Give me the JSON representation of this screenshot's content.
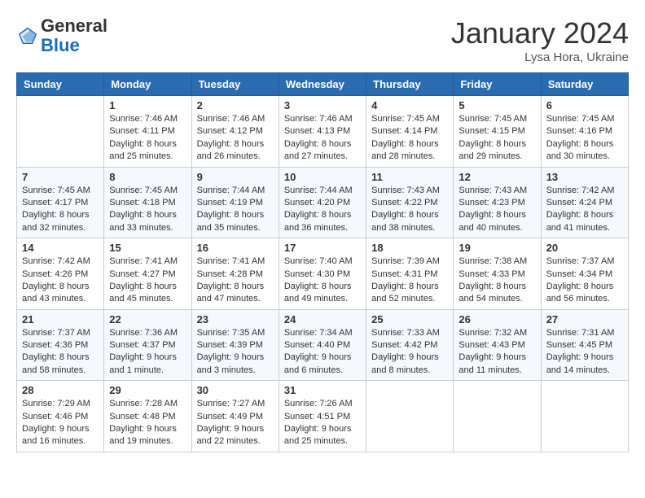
{
  "header": {
    "logo_general": "General",
    "logo_blue": "Blue",
    "month": "January 2024",
    "location": "Lysa Hora, Ukraine"
  },
  "columns": [
    "Sunday",
    "Monday",
    "Tuesday",
    "Wednesday",
    "Thursday",
    "Friday",
    "Saturday"
  ],
  "weeks": [
    [
      {
        "day": "",
        "content": ""
      },
      {
        "day": "1",
        "content": "Sunrise: 7:46 AM\nSunset: 4:11 PM\nDaylight: 8 hours\nand 25 minutes."
      },
      {
        "day": "2",
        "content": "Sunrise: 7:46 AM\nSunset: 4:12 PM\nDaylight: 8 hours\nand 26 minutes."
      },
      {
        "day": "3",
        "content": "Sunrise: 7:46 AM\nSunset: 4:13 PM\nDaylight: 8 hours\nand 27 minutes."
      },
      {
        "day": "4",
        "content": "Sunrise: 7:45 AM\nSunset: 4:14 PM\nDaylight: 8 hours\nand 28 minutes."
      },
      {
        "day": "5",
        "content": "Sunrise: 7:45 AM\nSunset: 4:15 PM\nDaylight: 8 hours\nand 29 minutes."
      },
      {
        "day": "6",
        "content": "Sunrise: 7:45 AM\nSunset: 4:16 PM\nDaylight: 8 hours\nand 30 minutes."
      }
    ],
    [
      {
        "day": "7",
        "content": "Sunrise: 7:45 AM\nSunset: 4:17 PM\nDaylight: 8 hours\nand 32 minutes."
      },
      {
        "day": "8",
        "content": "Sunrise: 7:45 AM\nSunset: 4:18 PM\nDaylight: 8 hours\nand 33 minutes."
      },
      {
        "day": "9",
        "content": "Sunrise: 7:44 AM\nSunset: 4:19 PM\nDaylight: 8 hours\nand 35 minutes."
      },
      {
        "day": "10",
        "content": "Sunrise: 7:44 AM\nSunset: 4:20 PM\nDaylight: 8 hours\nand 36 minutes."
      },
      {
        "day": "11",
        "content": "Sunrise: 7:43 AM\nSunset: 4:22 PM\nDaylight: 8 hours\nand 38 minutes."
      },
      {
        "day": "12",
        "content": "Sunrise: 7:43 AM\nSunset: 4:23 PM\nDaylight: 8 hours\nand 40 minutes."
      },
      {
        "day": "13",
        "content": "Sunrise: 7:42 AM\nSunset: 4:24 PM\nDaylight: 8 hours\nand 41 minutes."
      }
    ],
    [
      {
        "day": "14",
        "content": "Sunrise: 7:42 AM\nSunset: 4:26 PM\nDaylight: 8 hours\nand 43 minutes."
      },
      {
        "day": "15",
        "content": "Sunrise: 7:41 AM\nSunset: 4:27 PM\nDaylight: 8 hours\nand 45 minutes."
      },
      {
        "day": "16",
        "content": "Sunrise: 7:41 AM\nSunset: 4:28 PM\nDaylight: 8 hours\nand 47 minutes."
      },
      {
        "day": "17",
        "content": "Sunrise: 7:40 AM\nSunset: 4:30 PM\nDaylight: 8 hours\nand 49 minutes."
      },
      {
        "day": "18",
        "content": "Sunrise: 7:39 AM\nSunset: 4:31 PM\nDaylight: 8 hours\nand 52 minutes."
      },
      {
        "day": "19",
        "content": "Sunrise: 7:38 AM\nSunset: 4:33 PM\nDaylight: 8 hours\nand 54 minutes."
      },
      {
        "day": "20",
        "content": "Sunrise: 7:37 AM\nSunset: 4:34 PM\nDaylight: 8 hours\nand 56 minutes."
      }
    ],
    [
      {
        "day": "21",
        "content": "Sunrise: 7:37 AM\nSunset: 4:36 PM\nDaylight: 8 hours\nand 58 minutes."
      },
      {
        "day": "22",
        "content": "Sunrise: 7:36 AM\nSunset: 4:37 PM\nDaylight: 9 hours\nand 1 minute."
      },
      {
        "day": "23",
        "content": "Sunrise: 7:35 AM\nSunset: 4:39 PM\nDaylight: 9 hours\nand 3 minutes."
      },
      {
        "day": "24",
        "content": "Sunrise: 7:34 AM\nSunset: 4:40 PM\nDaylight: 9 hours\nand 6 minutes."
      },
      {
        "day": "25",
        "content": "Sunrise: 7:33 AM\nSunset: 4:42 PM\nDaylight: 9 hours\nand 8 minutes."
      },
      {
        "day": "26",
        "content": "Sunrise: 7:32 AM\nSunset: 4:43 PM\nDaylight: 9 hours\nand 11 minutes."
      },
      {
        "day": "27",
        "content": "Sunrise: 7:31 AM\nSunset: 4:45 PM\nDaylight: 9 hours\nand 14 minutes."
      }
    ],
    [
      {
        "day": "28",
        "content": "Sunrise: 7:29 AM\nSunset: 4:46 PM\nDaylight: 9 hours\nand 16 minutes."
      },
      {
        "day": "29",
        "content": "Sunrise: 7:28 AM\nSunset: 4:48 PM\nDaylight: 9 hours\nand 19 minutes."
      },
      {
        "day": "30",
        "content": "Sunrise: 7:27 AM\nSunset: 4:49 PM\nDaylight: 9 hours\nand 22 minutes."
      },
      {
        "day": "31",
        "content": "Sunrise: 7:26 AM\nSunset: 4:51 PM\nDaylight: 9 hours\nand 25 minutes."
      },
      {
        "day": "",
        "content": ""
      },
      {
        "day": "",
        "content": ""
      },
      {
        "day": "",
        "content": ""
      }
    ]
  ]
}
